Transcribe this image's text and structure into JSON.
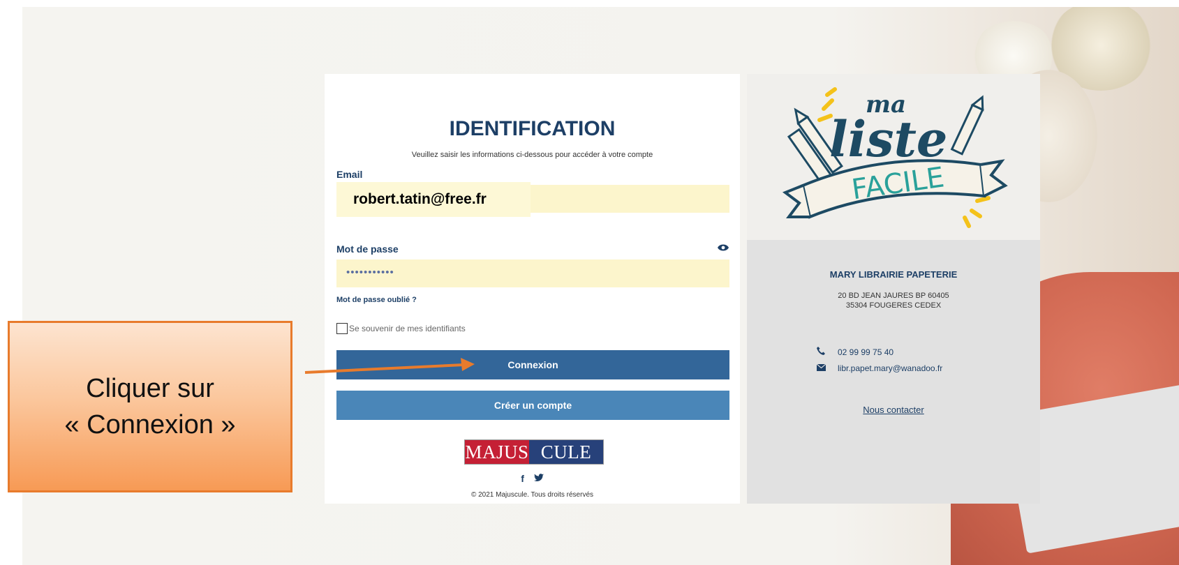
{
  "login": {
    "title": "IDENTIFICATION",
    "subtitle": "Veuillez saisir les informations ci-dessous pour accéder à votre compte",
    "email_label": "Email",
    "email_value": "robert.tatin@free.fr",
    "password_label": "Mot de passe",
    "password_value": "•••••••••••",
    "forgot_link": "Mot de passe oublié ?",
    "remember_label": "Se souvenir de mes identifiants",
    "login_button": "Connexion",
    "create_button": "Créer un compte",
    "brand_left": "MAJUS",
    "brand_right": "CULE",
    "social_facebook": "f",
    "social_twitter": "🐦",
    "copyright": "© 2021 Majuscule. Tous droits réservés"
  },
  "logo_panel": {
    "logo_ma": "ma",
    "logo_liste": "liste",
    "logo_facile": "FACILE"
  },
  "shop": {
    "name": "MARY LIBRAIRIE PAPETERIE",
    "address_line1": "20 BD JEAN JAURES BP 60405",
    "address_line2": "35304 FOUGERES CEDEX",
    "phone": "02 99 99 75 40",
    "email": "libr.papet.mary@wanadoo.fr",
    "contact_link": "Nous contacter"
  },
  "annotation": {
    "line1": "Cliquer sur",
    "line2": "« Connexion »"
  },
  "colors": {
    "brand_blue": "#1d3f66",
    "button_blue": "#336699",
    "field_yellow": "#fcf5cc",
    "callout_orange": "#f79a55"
  },
  "icons": [
    "eye-icon",
    "phone-icon",
    "mail-icon",
    "facebook-icon",
    "twitter-icon",
    "arrow-icon"
  ]
}
